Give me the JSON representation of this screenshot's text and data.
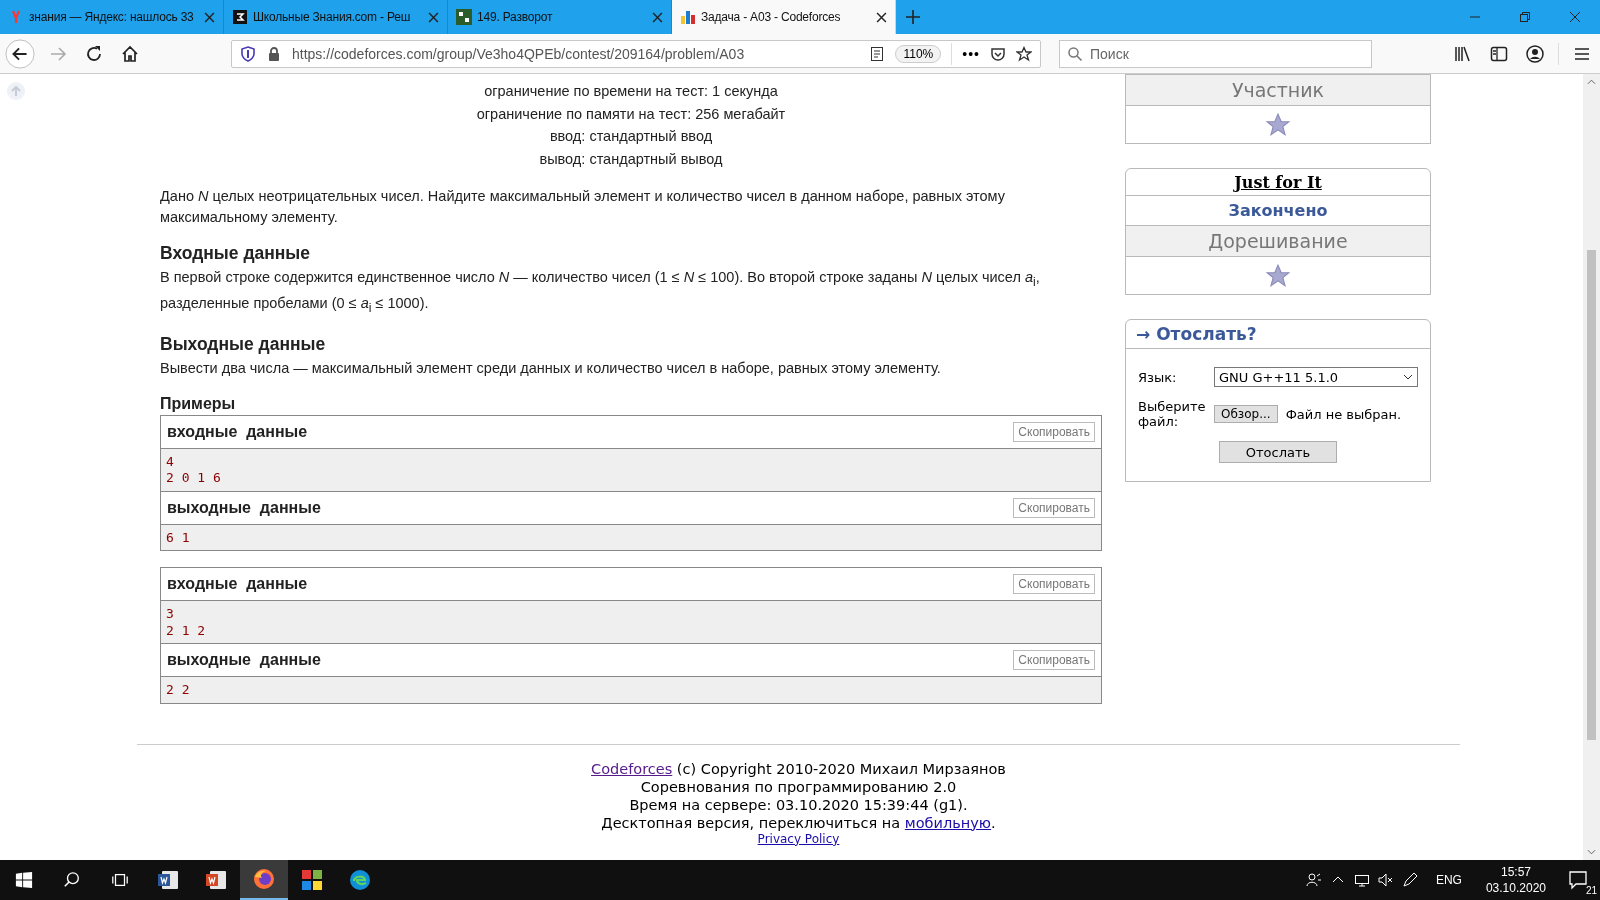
{
  "browser": {
    "tabs": [
      {
        "title": "знания — Яндекс: нашлось 33",
        "kind": "yandex",
        "selected": false
      },
      {
        "title": "Школьные Знания.com - Реш",
        "kind": "znania",
        "selected": false
      },
      {
        "title": "149. Разворот",
        "kind": "acmp",
        "selected": false
      },
      {
        "title": "Задача - A03 - Codeforces",
        "kind": "codeforces",
        "selected": true
      }
    ],
    "url": "https://codeforces.com/group/Ve3ho4QPEb/contest/209164/problem/A03",
    "zoom": "110%",
    "more": "•••",
    "search_placeholder": "Поиск"
  },
  "problem": {
    "limits": [
      "ограничение по времени на тест: 1 секунда",
      "ограничение по памяти на тест: 256 мегабайт",
      "ввод: стандартный ввод",
      "вывод: стандартный вывод"
    ],
    "legend": "Дано *N* целых неотрицательных чисел. Найдите максимальный элемент и количество чисел в данном наборе, равных этому максимальному элементу.",
    "sections": [
      {
        "title": "Входные данные",
        "text": "В первой строке содержится единственное число *N* — количество чисел (1 ≤ *N* ≤ 100). Во второй строке заданы *N* целых чисел *a*$_{i}$, разделенные пробелами (0 ≤ *a*$_{i}$ ≤ 1000)."
      },
      {
        "title": "Выходные данные",
        "text": "Вывести два числа — максимальный элемент среди данных и количество чисел в наборе, равных этому элементу."
      }
    ],
    "examples_title": "Примеры",
    "tests": [
      {
        "blocks": [
          {
            "title": "входные  данные",
            "copy": "Скопировать",
            "lines": [
              "4",
              "2 0 1 6"
            ]
          },
          {
            "title": "выходные  данные",
            "copy": "Скопировать",
            "lines": [
              "6 1"
            ]
          }
        ]
      },
      {
        "blocks": [
          {
            "title": "входные  данные",
            "copy": "Скопировать",
            "lines": [
              "3",
              "2 1 2"
            ]
          },
          {
            "title": "выходные  данные",
            "copy": "Скопировать",
            "lines": [
              "2 2"
            ]
          }
        ]
      }
    ]
  },
  "sidebar": {
    "participant_box": {
      "role": "Участник"
    },
    "contest_box": {
      "name": "Just for It",
      "status": "Закончено",
      "phase": "Дорешивание"
    },
    "submit_box": {
      "title": "→ Отослать?",
      "language_label": "Язык:",
      "language": "GNU G++11 5.1.0",
      "file_label": "Выберите файл:",
      "browse": "Обзор...",
      "no_file": "Файл не выбран.",
      "submit": "Отослать"
    }
  },
  "footer": {
    "lines": [
      [
        {
          "kind": "link",
          "text": "Codeforces"
        },
        {
          "kind": "text",
          "text": " (c) Copyright 2010-2020 Михаил Мирзаянов"
        }
      ],
      [
        {
          "kind": "text",
          "text": "Соревнования по программированию 2.0"
        }
      ],
      [
        {
          "kind": "text",
          "text": "Время на сервере: 03.10.2020 15:39:44 (g1)."
        }
      ],
      [
        {
          "kind": "text",
          "text": "Десктопная версия, переключиться на "
        },
        {
          "kind": "link",
          "text": "мобильную"
        },
        {
          "kind": "text",
          "text": "."
        }
      ]
    ],
    "privacy": "Privacy Policy"
  },
  "taskbar": {
    "apps": [
      {
        "kind": "word",
        "selected": false
      },
      {
        "kind": "powerpoint",
        "selected": false
      },
      {
        "kind": "firefox",
        "selected": true
      },
      {
        "kind": "tiles",
        "selected": false
      },
      {
        "kind": "edge",
        "selected": false
      }
    ],
    "language": "ENG",
    "time": "15:57",
    "date": "03.10.2020",
    "notifications": "21"
  }
}
